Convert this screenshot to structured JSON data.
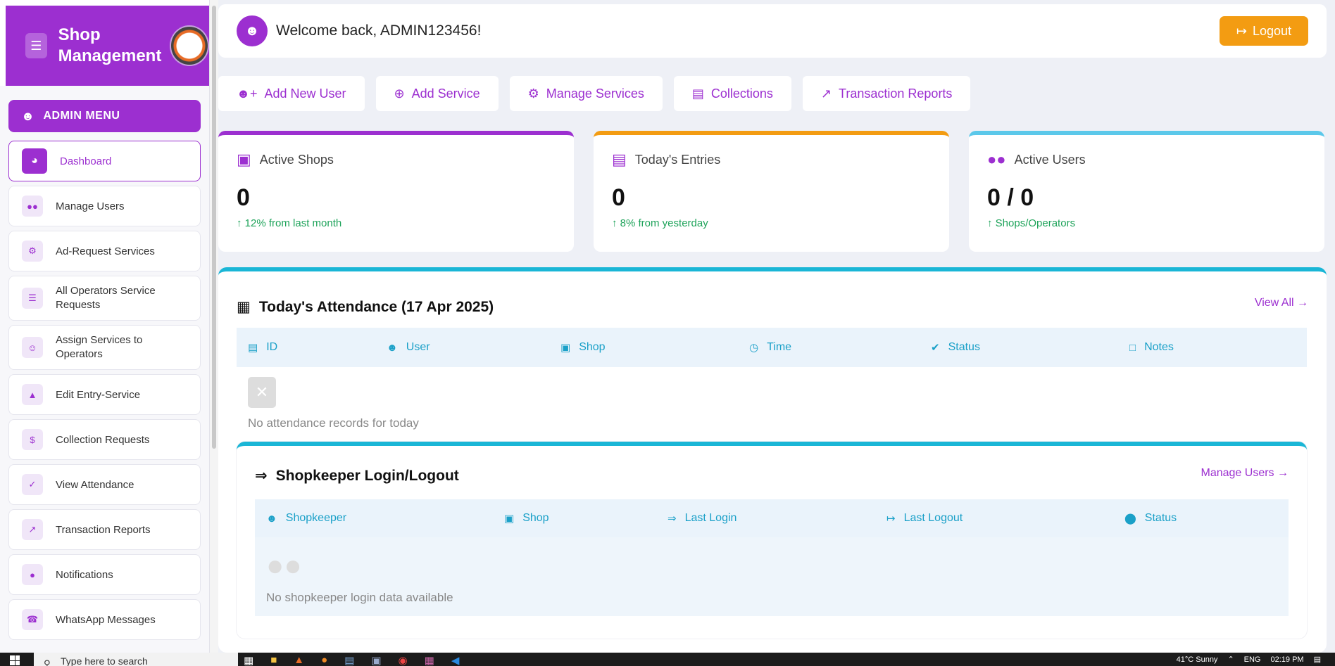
{
  "sidebar": {
    "brand_title": "Shop Management",
    "section_label": "ADMIN MENU",
    "items": [
      {
        "label": "Dashboard",
        "icon": "dashboard-icon",
        "active": true
      },
      {
        "label": "Manage Users",
        "icon": "users-icon"
      },
      {
        "label": "Ad-Request Services",
        "icon": "gears-icon"
      },
      {
        "label": "All Operators Service Requests",
        "icon": "list-icon"
      },
      {
        "label": "Assign Services to Operators",
        "icon": "user-gear-icon"
      },
      {
        "label": "Edit Entry-Service",
        "icon": "bell-concierge-icon"
      },
      {
        "label": "Collection Requests",
        "icon": "money-icon"
      },
      {
        "label": "View Attendance",
        "icon": "calendar-check-icon"
      },
      {
        "label": "Transaction Reports",
        "icon": "chart-line-icon"
      },
      {
        "label": "Notifications",
        "icon": "bell-icon"
      },
      {
        "label": "WhatsApp Messages",
        "icon": "whatsapp-icon"
      }
    ]
  },
  "header": {
    "welcome": "Welcome back, ADMIN123456!",
    "logout_label": "Logout"
  },
  "actions": [
    {
      "label": "Add New User",
      "icon": "user-plus-icon"
    },
    {
      "label": "Add Service",
      "icon": "plus-circle-icon"
    },
    {
      "label": "Manage Services",
      "icon": "gears-icon"
    },
    {
      "label": "Collections",
      "icon": "money-bill-icon"
    },
    {
      "label": "Transaction Reports",
      "icon": "chart-line-icon"
    }
  ],
  "stats": [
    {
      "title": "Active Shops",
      "value": "0",
      "trend": "12% from last month",
      "color": "#9c2fd0",
      "icon": "store-icon"
    },
    {
      "title": "Today's Entries",
      "value": "0",
      "trend": "8% from yesterday",
      "color": "#f39c12",
      "icon": "clipboard-list-icon"
    },
    {
      "title": "Active Users",
      "value": "0 / 0",
      "trend": "Shops/Operators",
      "color": "#5bc8ea",
      "icon": "users-icon"
    }
  ],
  "attendance": {
    "title": "Today's Attendance (17 Apr 2025)",
    "view_all": "View All",
    "columns": [
      "ID",
      "User",
      "Shop",
      "Time",
      "Status",
      "Notes"
    ],
    "empty_text": "No attendance records for today"
  },
  "shopkeeper": {
    "title": "Shopkeeper Login/Logout",
    "manage_link": "Manage Users",
    "columns": [
      "Shopkeeper",
      "Shop",
      "Last Login",
      "Last Logout",
      "Status"
    ],
    "empty_text": "No shopkeeper login data available"
  },
  "taskbar": {
    "search_placeholder": "Type here to search",
    "weather": "41°C Sunny",
    "lang": "ENG",
    "time": "02:19 PM"
  }
}
